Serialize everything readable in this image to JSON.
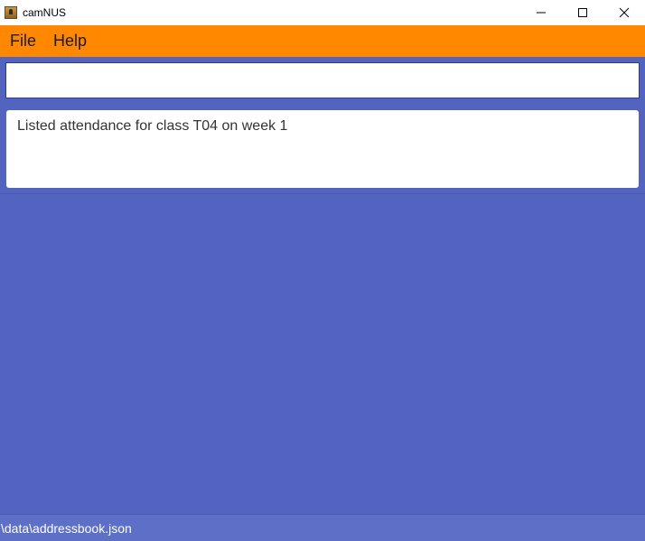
{
  "window": {
    "title": "camNUS",
    "icons": {
      "app": "app-icon",
      "minimize": "minimize-icon",
      "maximize": "maximize-icon",
      "close": "close-icon"
    }
  },
  "menu": {
    "items": [
      {
        "label": "File"
      },
      {
        "label": "Help"
      }
    ]
  },
  "command_box": {
    "value": "",
    "placeholder": ""
  },
  "result_display": {
    "text": "Listed attendance for class T04 on week 1"
  },
  "status_bar": {
    "save_location": "\\data\\addressbook.json"
  },
  "colors": {
    "menu_bar": "#ff8800",
    "background": "#5264c0",
    "status_bar": "#5d6fc6"
  }
}
